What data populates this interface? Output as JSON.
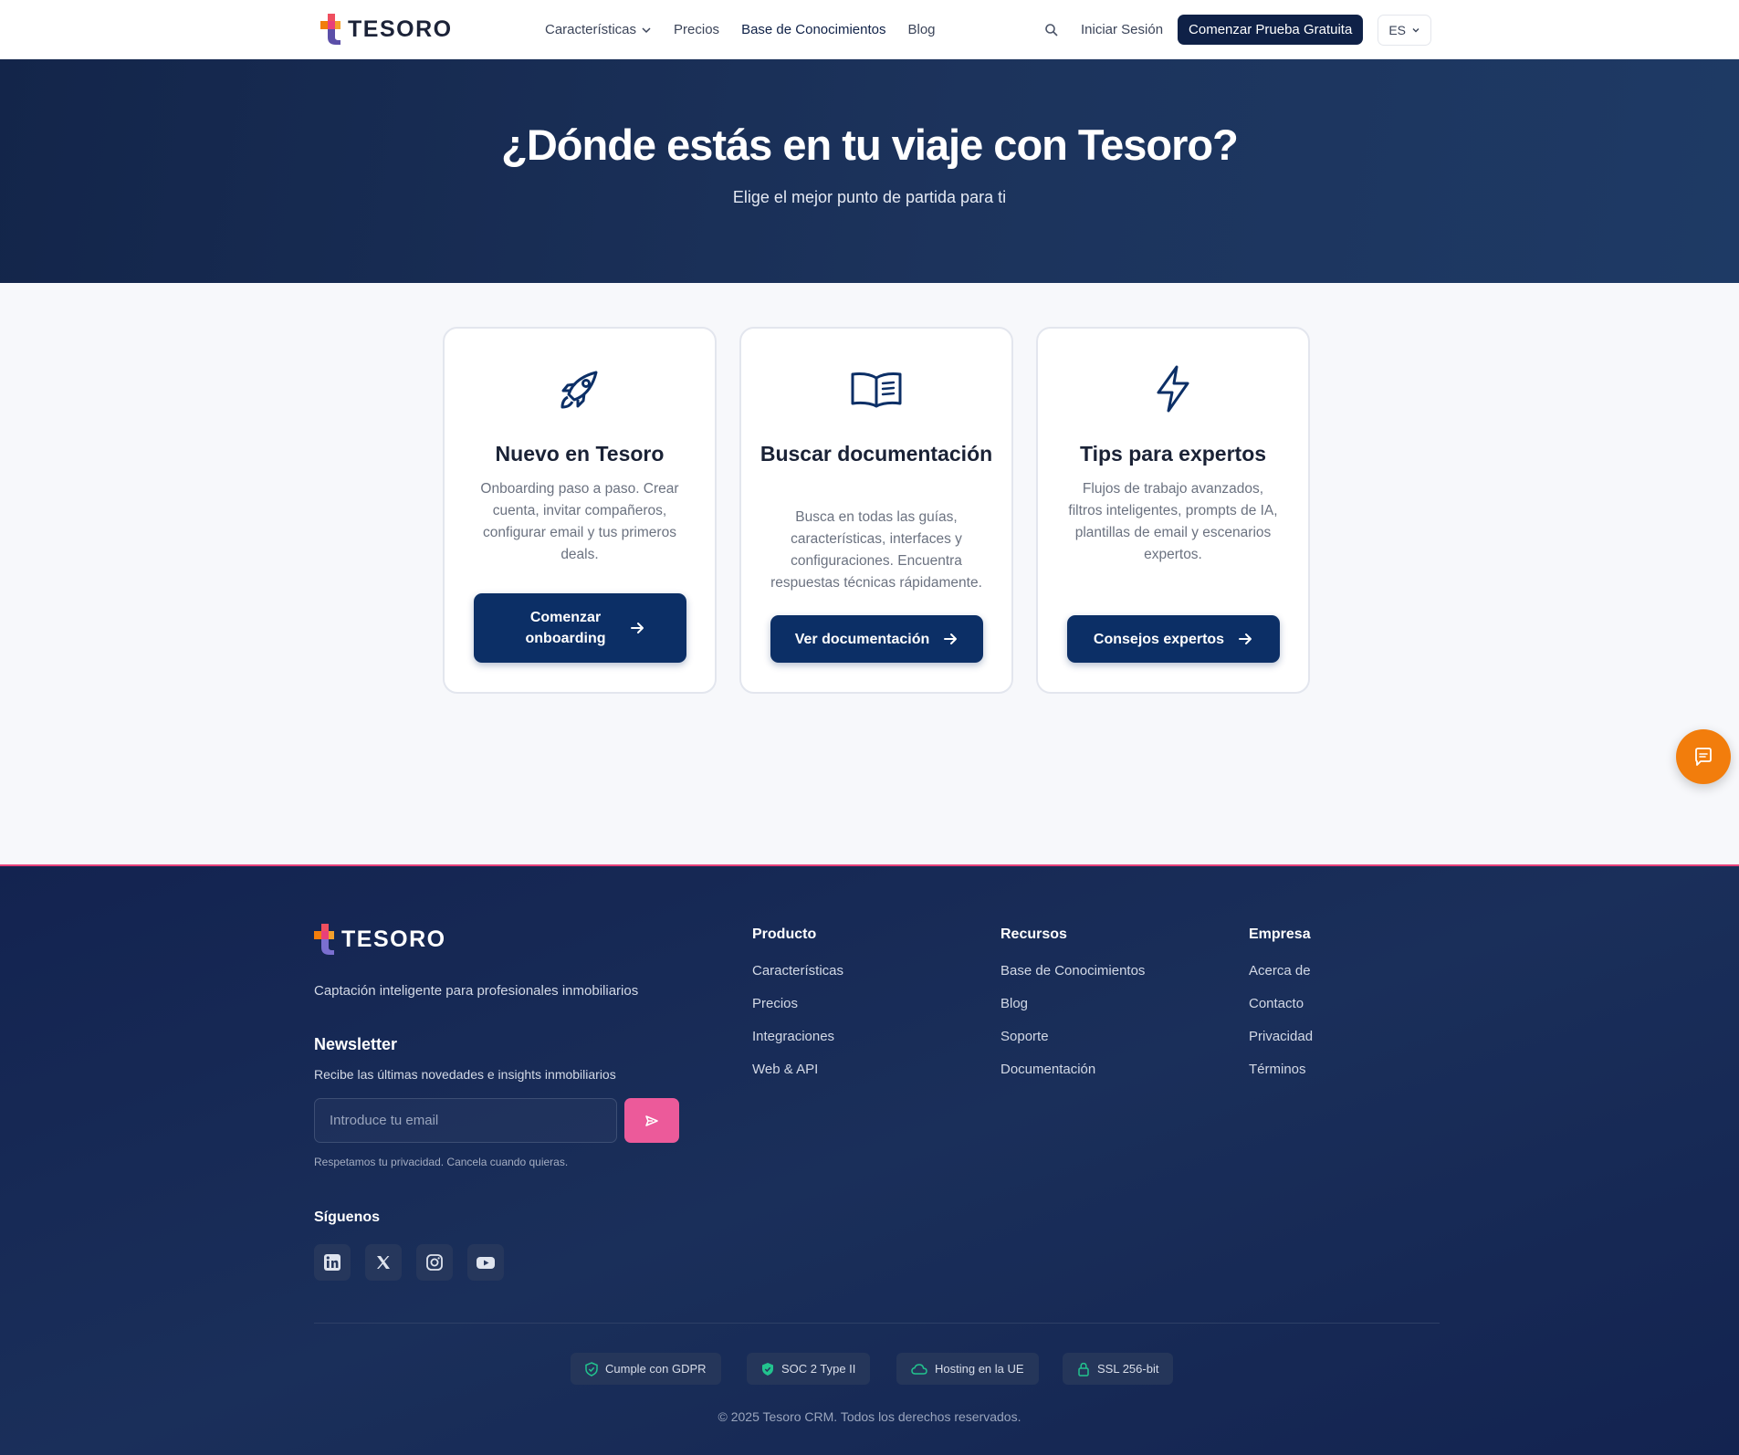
{
  "brand": {
    "name": "TESORO"
  },
  "nav": {
    "links": [
      {
        "label": "Características"
      },
      {
        "label": "Precios"
      },
      {
        "label": "Base de Conocimientos"
      },
      {
        "label": "Blog"
      }
    ],
    "login": "Iniciar Sesión",
    "cta": "Comenzar Prueba Gratuita",
    "lang": "ES"
  },
  "hero": {
    "title": "¿Dónde estás en tu viaje con Tesoro?",
    "subtitle": "Elige el mejor punto de partida para ti"
  },
  "cards": [
    {
      "icon": "rocket-icon",
      "title": "Nuevo en Tesoro",
      "description": "Onboarding paso a paso. Crear cuenta, invitar compañeros, configurar email y tus primeros deals.",
      "button": "Comenzar onboarding"
    },
    {
      "icon": "book-icon",
      "title": "Buscar documentación",
      "description": "Busca en todas las guías, características, interfaces y configuraciones. Encuentra respuestas técnicas rápidamente.",
      "button": "Ver documentación"
    },
    {
      "icon": "lightning-icon",
      "title": "Tips para expertos",
      "description": "Flujos de trabajo avanzados, filtros inteligentes, prompts de IA, plantillas de email y escenarios expertos.",
      "button": "Consejos expertos"
    }
  ],
  "footer": {
    "tagline": "Captación inteligente para profesionales inmobiliarios",
    "newsletter": {
      "title": "Newsletter",
      "subtitle": "Recibe las últimas novedades e insights inmobiliarios",
      "placeholder": "Introduce tu email",
      "privacy": "Respetamos tu privacidad. Cancela cuando quieras."
    },
    "follow": "Síguenos",
    "columns": [
      {
        "title": "Producto",
        "links": [
          "Características",
          "Precios",
          "Integraciones",
          "Web & API"
        ]
      },
      {
        "title": "Recursos",
        "links": [
          "Base de Conocimientos",
          "Blog",
          "Soporte",
          "Documentación"
        ]
      },
      {
        "title": "Empresa",
        "links": [
          "Acerca de",
          "Contacto",
          "Privacidad",
          "Términos"
        ]
      }
    ],
    "badges": [
      "Cumple con GDPR",
      "SOC 2 Type II",
      "Hosting en la UE",
      "SSL 256-bit"
    ],
    "copyright": "© 2025 Tesoro CRM. Todos los derechos reservados."
  },
  "colors": {
    "navy": "#0f2147",
    "button": "#0c2f66",
    "accent_orange": "#f27d0c",
    "accent_pink": "#ec5a9a",
    "badge_green": "#22c38e"
  }
}
